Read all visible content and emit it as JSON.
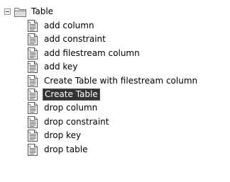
{
  "tree": {
    "root": {
      "label": "Table",
      "expanded": true,
      "expander_icon": "minus-box-icon",
      "icon": "folder-icon"
    },
    "items": [
      {
        "label": "add column",
        "icon": "snippet-file-icon",
        "selected": false
      },
      {
        "label": "add constraint",
        "icon": "snippet-file-icon",
        "selected": false
      },
      {
        "label": "add filestream column",
        "icon": "snippet-file-icon",
        "selected": false
      },
      {
        "label": "add key",
        "icon": "snippet-file-icon",
        "selected": false
      },
      {
        "label": "Create Table with filestream column",
        "icon": "snippet-file-icon",
        "selected": false
      },
      {
        "label": "Create Table",
        "icon": "snippet-file-icon",
        "selected": true
      },
      {
        "label": "drop column",
        "icon": "snippet-file-icon",
        "selected": false
      },
      {
        "label": "drop constraint",
        "icon": "snippet-file-icon",
        "selected": false
      },
      {
        "label": "drop key",
        "icon": "snippet-file-icon",
        "selected": false
      },
      {
        "label": "drop table",
        "icon": "snippet-file-icon",
        "selected": false
      }
    ]
  },
  "colors": {
    "selection_background": "#333333",
    "selection_text": "#ffffff",
    "text": "#000000"
  }
}
